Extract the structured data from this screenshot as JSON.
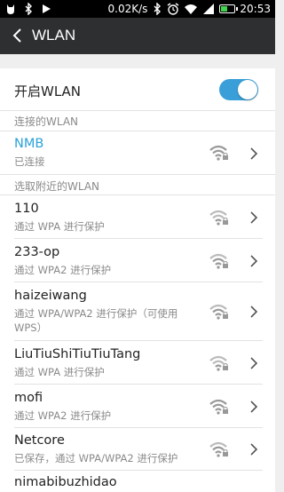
{
  "status_bar": {
    "icons_left": [
      "cat-icon",
      "bluetooth-icon",
      "play-icon"
    ],
    "speed": "0.02K/s",
    "time": "20:53",
    "battery_level": 0.5
  },
  "header": {
    "title": "WLAN"
  },
  "wlan_toggle": {
    "label": "开启WLAN",
    "on": true,
    "color": "#3a9fd8"
  },
  "connected_section": {
    "label": "连接的WLAN"
  },
  "connected": {
    "name": "NMB",
    "status": "已连接",
    "name_color": "#2ba2d9"
  },
  "nearby_section": {
    "label": "选取附近的WLAN"
  },
  "networks": [
    {
      "name": "110",
      "status": "通过 WPA 进行保护"
    },
    {
      "name": "233-op",
      "status": "通过 WPA2 进行保护"
    },
    {
      "name": "haizeiwang",
      "status": "通过 WPA/WPA2 进行保护（可使用 WPS）"
    },
    {
      "name": "LiuTiuShiTiuTiuTang",
      "status": "通过 WPA 进行保护"
    },
    {
      "name": "mofi",
      "status": "通过 WPA2 进行保护"
    },
    {
      "name": "Netcore",
      "status": "已保存，通过 WPA/WPA2 进行保护"
    },
    {
      "name": "nimabibuzhidao",
      "status": ""
    }
  ]
}
